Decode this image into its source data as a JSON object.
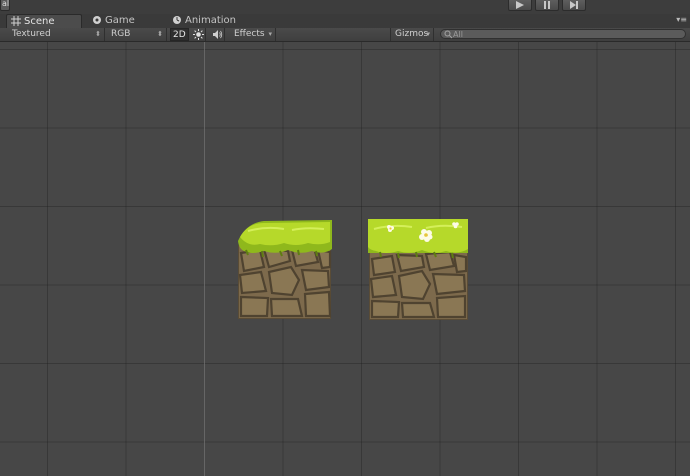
{
  "topbar": {
    "layout_label": "al",
    "play_controls": [
      "play-icon",
      "pause-icon",
      "step-icon"
    ]
  },
  "tabs": [
    {
      "label": "Scene",
      "icon": "grid-icon",
      "active": true
    },
    {
      "label": "Game",
      "icon": "game-icon",
      "active": false
    },
    {
      "label": "Animation",
      "icon": "animation-icon",
      "active": false
    }
  ],
  "tab_menu_icon": "panel-menu-icon",
  "toolbar": {
    "shading_mode": "Textured",
    "channel_mode": "RGB",
    "mode_2d": "2D",
    "lighting_icon": "sun-icon",
    "audio_icon": "audio-icon",
    "effects": "Effects",
    "gizmos": "Gizmos",
    "search_placeholder": "All"
  },
  "scene": {
    "sprites": [
      {
        "name": "ground-tile-left",
        "style": "grass-top-stone"
      },
      {
        "name": "ground-tile-right",
        "style": "grass-top-stone-flowers"
      }
    ]
  },
  "colors": {
    "scene_background": "#474747",
    "toolbar": "#434343",
    "grass": "#b6d92a",
    "stone": "#7d6a4c",
    "stone_outline": "#4f4330"
  }
}
